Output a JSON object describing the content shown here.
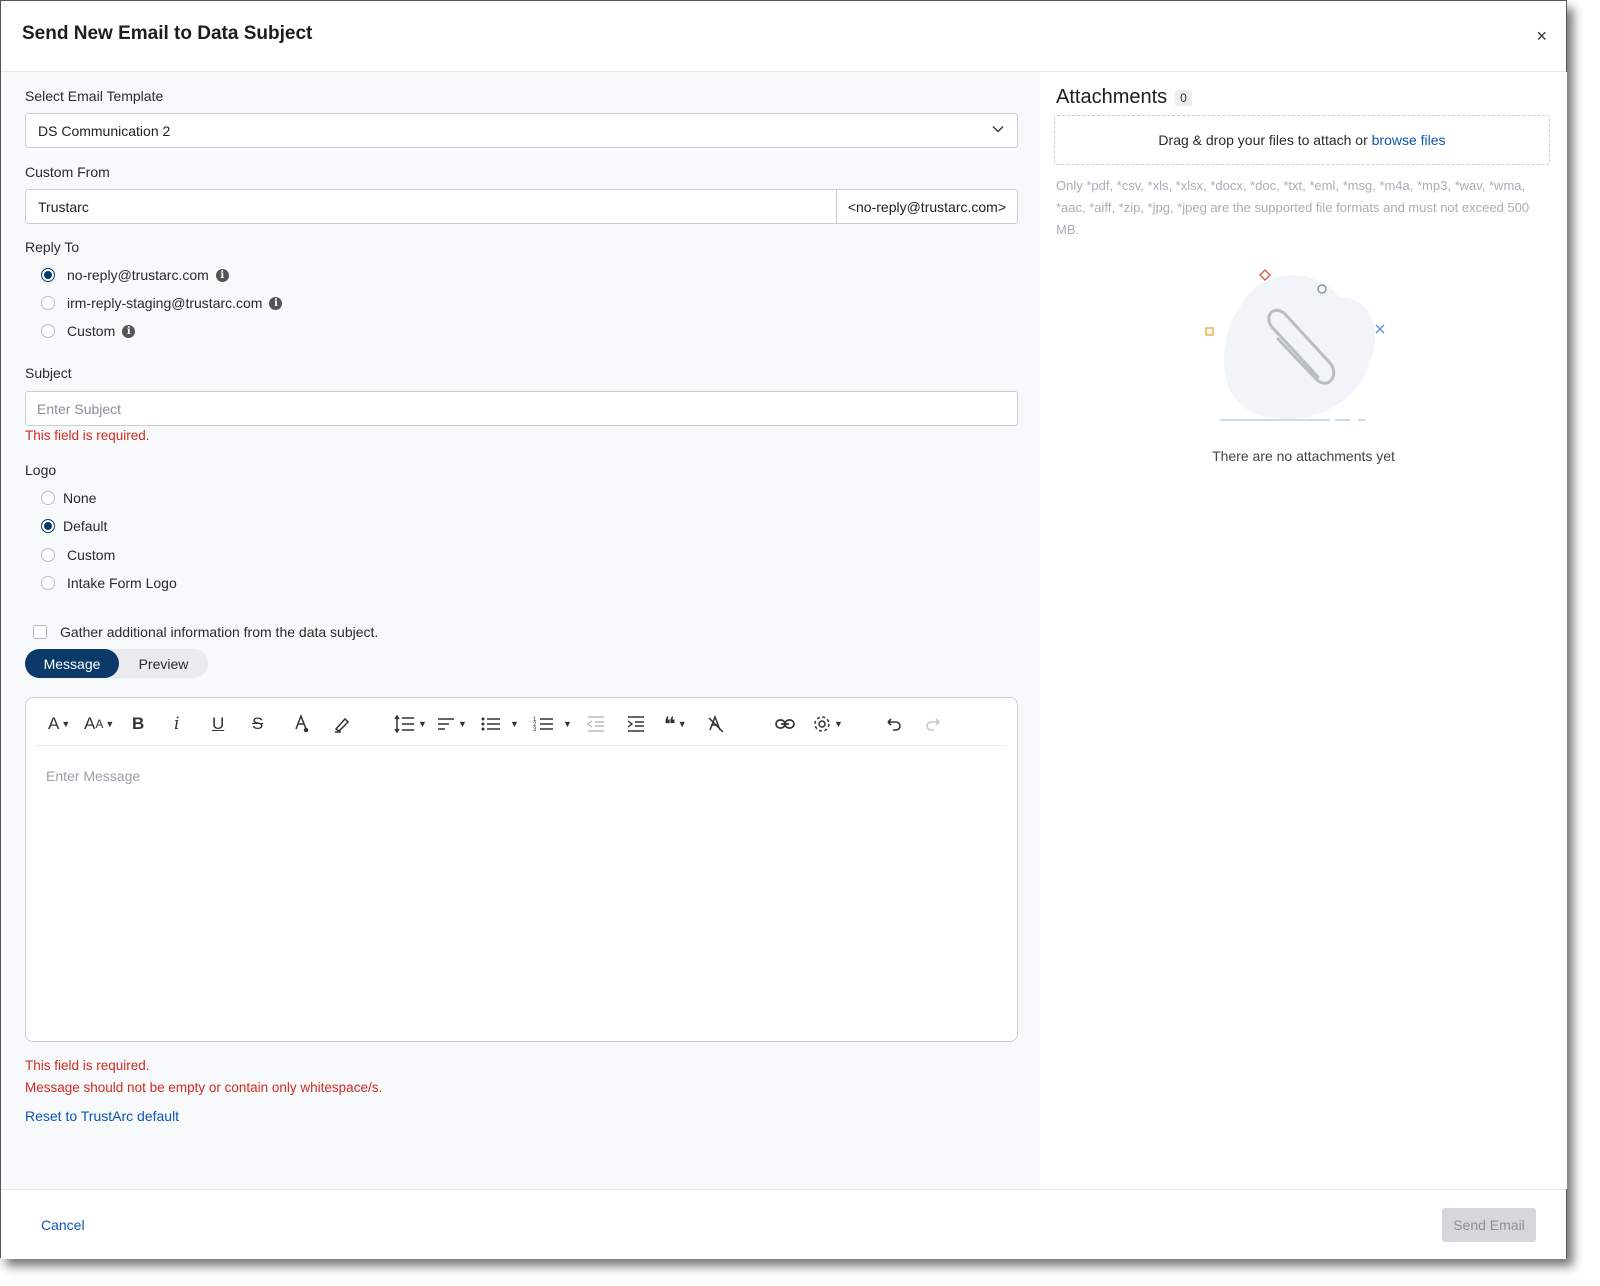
{
  "modal": {
    "title": "Send New Email to Data Subject",
    "close_label": "×"
  },
  "template": {
    "label": "Select Email Template",
    "value": "DS Communication 2"
  },
  "custom_from": {
    "label": "Custom From",
    "value": "Trustarc",
    "addon": "<no-reply@trustarc.com>"
  },
  "reply_to": {
    "label": "Reply To",
    "options": [
      {
        "label": "no-reply@trustarc.com",
        "selected": true
      },
      {
        "label": "irm-reply-staging@trustarc.com",
        "selected": false
      },
      {
        "label": "Custom",
        "selected": false
      }
    ]
  },
  "subject": {
    "label": "Subject",
    "placeholder": "Enter Subject",
    "error": "This field is required."
  },
  "logo": {
    "label": "Logo",
    "options": [
      {
        "label": "None",
        "selected": false
      },
      {
        "label": "Default",
        "selected": true
      },
      {
        "label": "Custom",
        "selected": false
      },
      {
        "label": "Intake Form Logo",
        "selected": false
      }
    ]
  },
  "gather_info": {
    "label": "Gather additional information from the data subject.",
    "checked": false
  },
  "tabs": {
    "message": "Message",
    "preview": "Preview",
    "active": "Message"
  },
  "editor": {
    "placeholder": "Enter Message",
    "toolbar_icons": [
      "font-family-icon",
      "font-size-icon",
      "bold-icon",
      "italic-icon",
      "underline-icon",
      "strikethrough-icon",
      "text-color-icon",
      "highlight-icon",
      "line-height-icon",
      "align-icon",
      "bulleted-list-icon",
      "numbered-list-icon",
      "outdent-icon",
      "indent-icon",
      "blockquote-icon",
      "clear-format-icon",
      "link-icon",
      "settings-icon",
      "undo-icon",
      "redo-icon"
    ]
  },
  "message_errors": {
    "required": "This field is required.",
    "whitespace": "Message should not be empty or contain only whitespace/s."
  },
  "reset_link": "Reset to TrustArc default",
  "attachments": {
    "title": "Attachments",
    "count": "0",
    "drop_text": "Drag & drop your files to attach or",
    "browse_link": "browse files",
    "hint": "Only *pdf, *csv, *xls, *xlsx, *docx, *doc, *txt, *eml, *msg, *m4a, *mp3, *wav, *wma, *aac, *aiff, *zip, *jpg, *jpeg are the supported file formats and must not exceed 500 MB.",
    "empty_text": "There are no attachments yet"
  },
  "footer": {
    "cancel": "Cancel",
    "send": "Send Email"
  },
  "colors": {
    "primary": "#0b3a6a",
    "link": "#0b56b3",
    "error": "#d02b20",
    "disabled_bg": "#d5d7da"
  }
}
